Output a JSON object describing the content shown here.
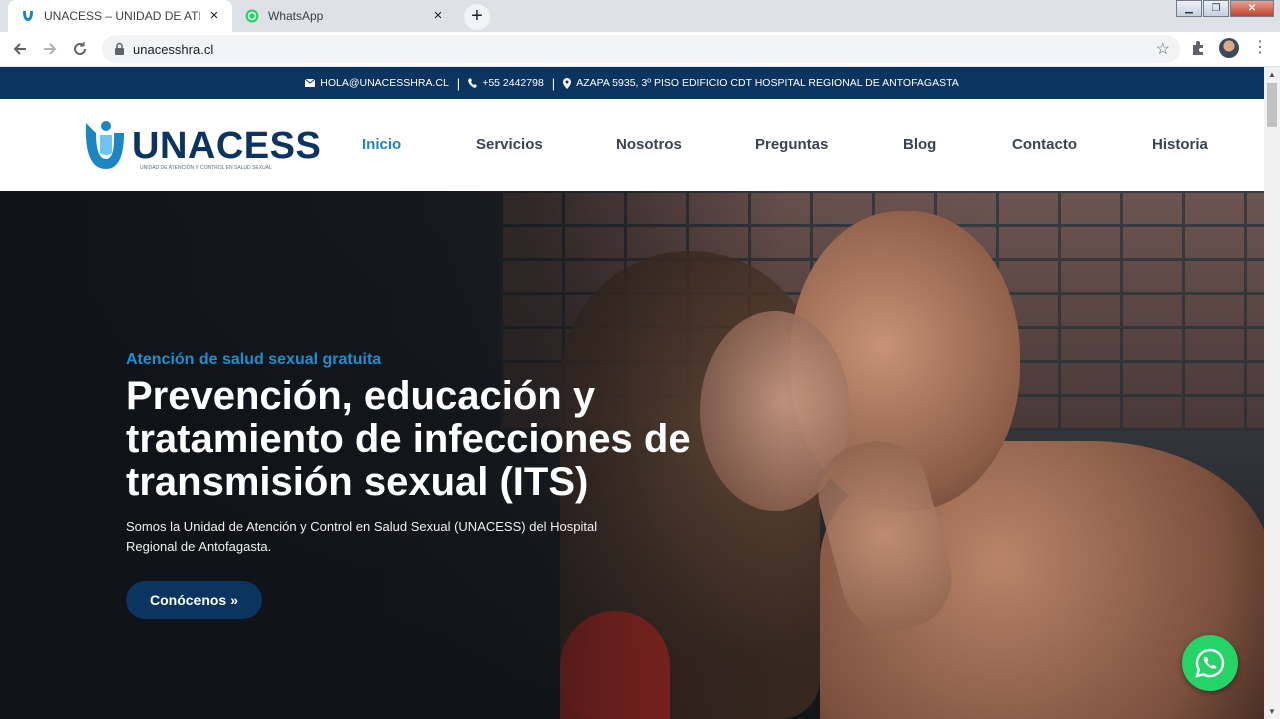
{
  "browser": {
    "tabs": [
      {
        "title": "UNACESS – UNIDAD DE ATENCIÓ",
        "favicon": "unacess-icon",
        "active": true
      },
      {
        "title": "WhatsApp",
        "favicon": "whatsapp-icon",
        "active": false
      }
    ],
    "new_tab_symbol": "+",
    "url": "unacesshra.cl"
  },
  "contact_bar": {
    "email": "HOLA@UNACESSHRA.CL",
    "phone": "+55 2442798",
    "address": "AZAPA 5935, 3º PISO EDIFICIO CDT HOSPITAL REGIONAL DE ANTOFAGASTA",
    "separator": "|"
  },
  "logo": {
    "word": "UNACESS",
    "tagline": "UNIDAD DE ATENCIÓN Y CONTROL EN SALUD SEXUAL"
  },
  "nav": {
    "items": [
      {
        "label": "Inicio",
        "active": true
      },
      {
        "label": "Servicios",
        "active": false
      },
      {
        "label": "Nosotros",
        "active": false
      },
      {
        "label": "Preguntas",
        "active": false
      },
      {
        "label": "Blog",
        "active": false
      },
      {
        "label": "Contacto",
        "active": false
      },
      {
        "label": "Historia",
        "active": false
      }
    ]
  },
  "hero": {
    "kicker": "Atención de salud sexual gratuita",
    "title": "Prevención, educación y tratamiento de infecciones de transmisión sexual (ITS)",
    "description": "Somos la Unidad de Atención y Control en Salud Sexual (UNACESS) del Hospital Regional de Antofagasta.",
    "button_label": "Conócenos",
    "button_icon": "double-chevron-right-icon"
  },
  "colors": {
    "brand_navy": "#0b3460",
    "accent_blue": "#1c86c5",
    "whatsapp_green": "#25d366"
  }
}
